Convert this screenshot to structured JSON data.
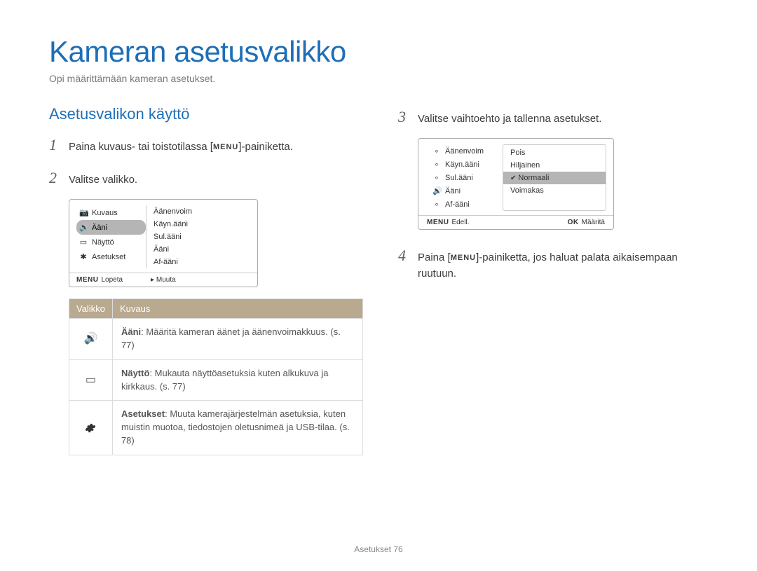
{
  "title": "Kameran asetusvalikko",
  "subtitle": "Opi määrittämään kameran asetukset.",
  "section_heading": "Asetusvalikon käyttö",
  "steps": {
    "s1_pre": "Paina kuvaus- tai toistotilassa [",
    "s1_menu": "MENU",
    "s1_post": "]-painiketta.",
    "s2": "Valitse valikko.",
    "s3": "Valitse vaihtoehto ja tallenna asetukset.",
    "s4_pre": "Paina [",
    "s4_menu": "MENU",
    "s4_post": "]-painiketta, jos haluat palata aikaisempaan ruutuun."
  },
  "screen1": {
    "left": [
      "Kuvaus",
      "Ääni",
      "Näyttö",
      "Asetukset"
    ],
    "right": [
      "Äänenvoim",
      "Käyn.ääni",
      "Sul.ääni",
      "Ääni",
      "Af-ääni"
    ],
    "footer_left_label": "MENU",
    "footer_left_text": "Lopeta",
    "footer_right_text": "Muuta"
  },
  "table": {
    "head_menu": "Valikko",
    "head_desc": "Kuvaus",
    "rows": [
      {
        "bold": "Ääni",
        "text": ": Määritä kameran äänet ja äänenvoimakkuus. (s. 77)"
      },
      {
        "bold": "Näyttö",
        "text": ": Mukauta näyttöasetuksia kuten alkukuva ja kirkkaus. (s. 77)"
      },
      {
        "bold": "Asetukset",
        "text": ": Muuta kamerajärjestelmän asetuksia, kuten muistin muotoa, tiedostojen oletusnimeä ja USB-tilaa. (s. 78)"
      }
    ]
  },
  "screen2": {
    "left": [
      "Äänenvoim",
      "Käyn.ääni",
      "Sul.ääni",
      "Ääni",
      "Af-ääni"
    ],
    "right": [
      "Pois",
      "Hiljainen",
      "Normaali",
      "Voimakas"
    ],
    "selected": "Normaali",
    "footer_left_label": "MENU",
    "footer_left_text": "Edell.",
    "footer_right_label": "OK",
    "footer_right_text": "Määritä"
  },
  "page_footer_label": "Asetukset",
  "page_footer_num": "76"
}
